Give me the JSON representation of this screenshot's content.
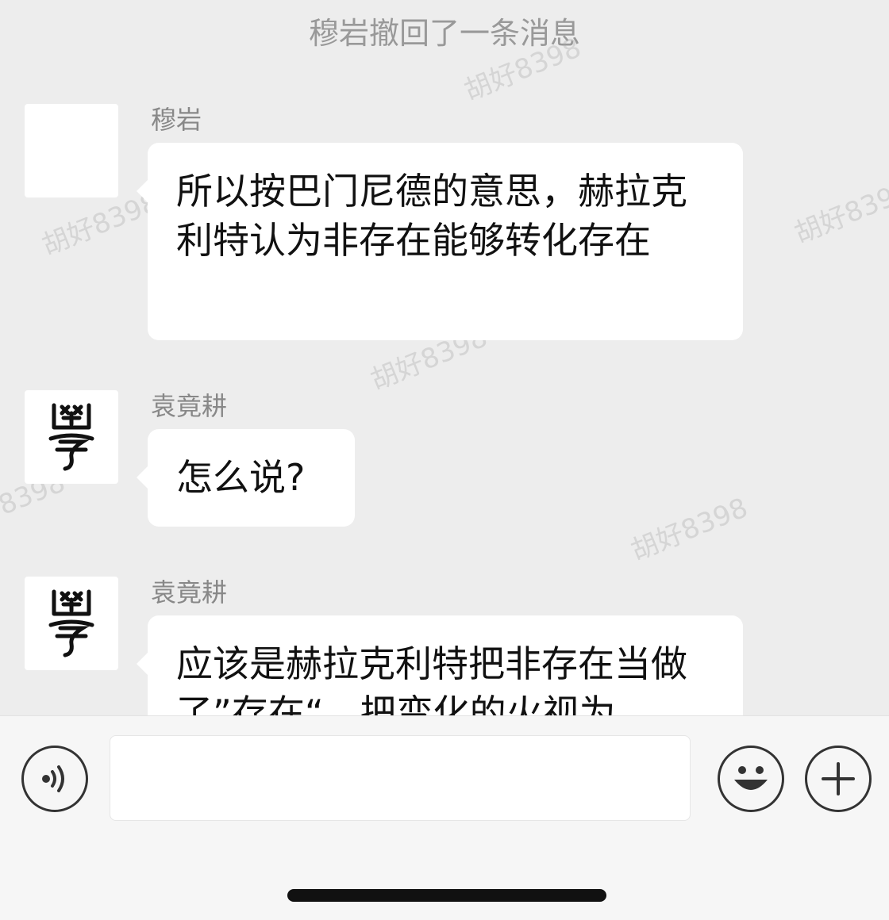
{
  "system_notice": "穆岩撤回了一条消息",
  "watermark_text": "胡好8398",
  "messages": [
    {
      "sender": "穆岩",
      "avatar": "blank-avatar",
      "text": "所以按巴门尼德的意思，赫拉克利特认为非存在能够转化存在"
    },
    {
      "sender": "袁竟耕",
      "avatar": "seal-script-avatar",
      "text": "怎么说?"
    },
    {
      "sender": "袁竟耕",
      "avatar": "seal-script-avatar",
      "text": "应该是赫拉克利特把非存在当做了”存在“，把变化的火视为"
    }
  ],
  "input_bar": {
    "voice_icon": "voice-icon",
    "emoji_icon": "emoji-icon",
    "plus_icon": "plus-icon",
    "input_value": ""
  },
  "colors": {
    "background": "#ededed",
    "bubble": "#ffffff",
    "notice_text": "#999999",
    "input_bar": "#f6f6f6"
  }
}
